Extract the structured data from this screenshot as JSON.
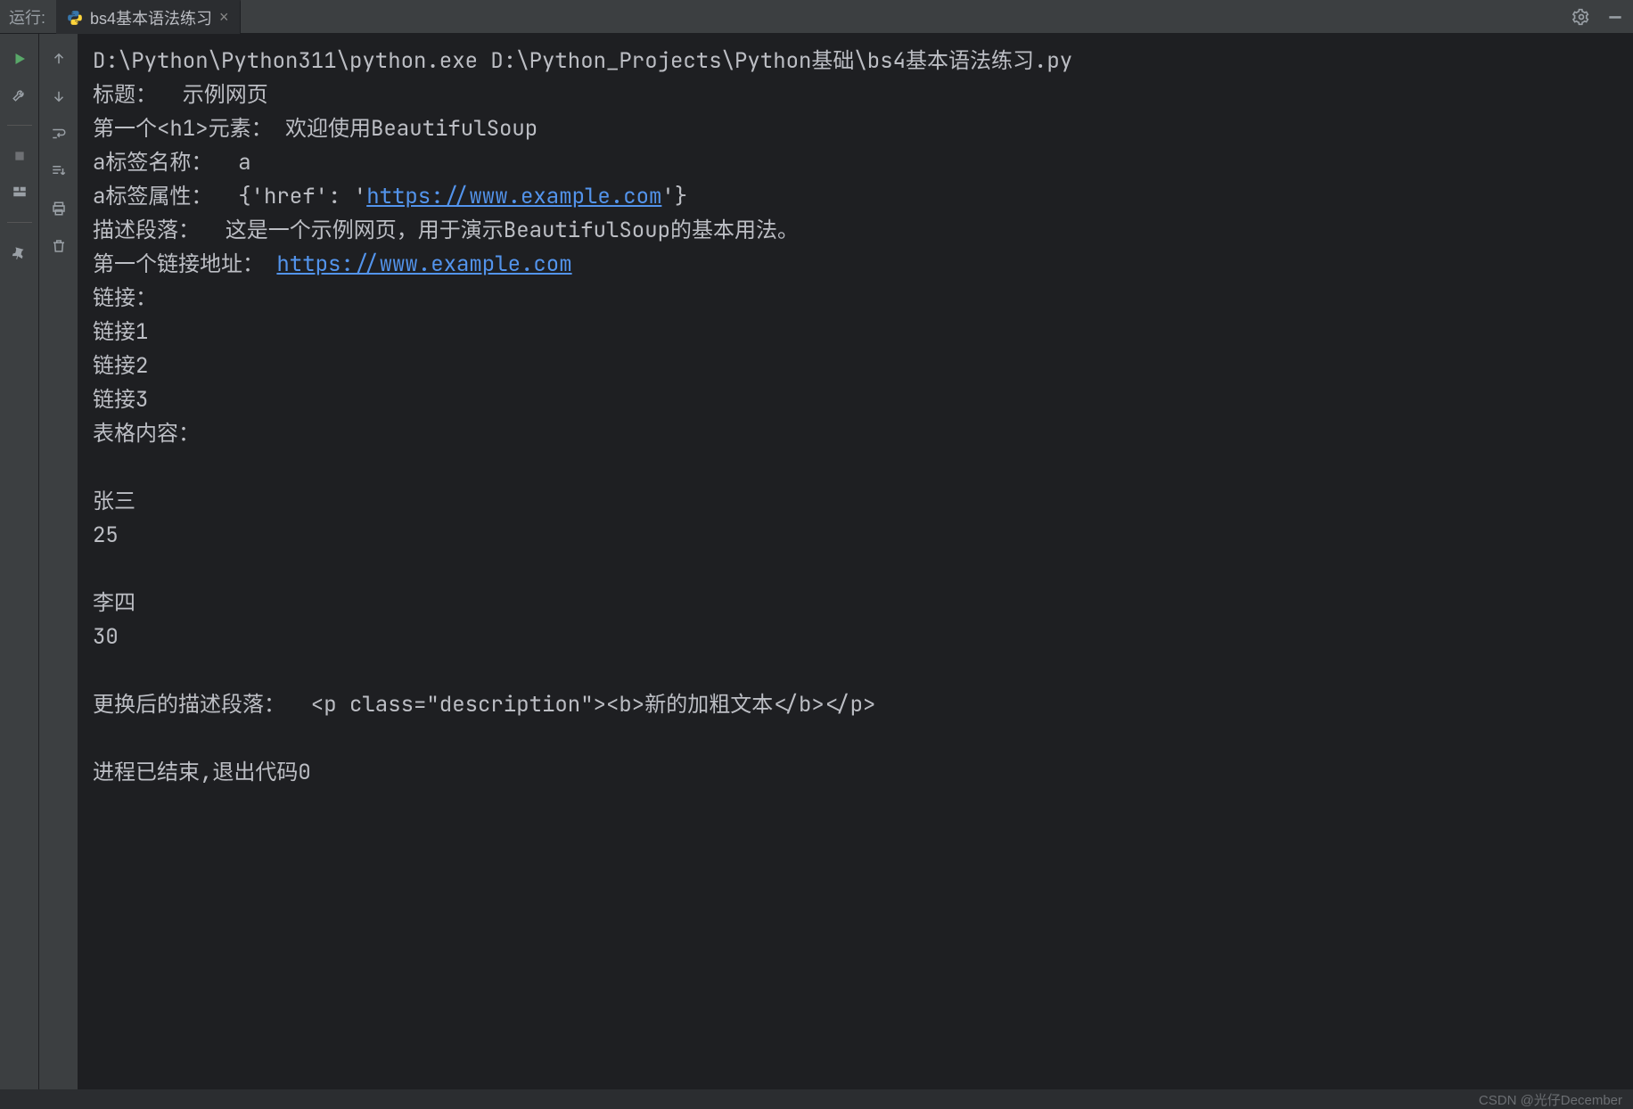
{
  "topbar": {
    "run_label": "运行:",
    "tab_title": "bs4基本语法练习",
    "tab_close": "×"
  },
  "console": {
    "cmd": "D:\\Python\\Python311\\python.exe D:\\Python_Projects\\Python基础\\bs4基本语法练习.py",
    "line_title": "标题：  示例网页",
    "line_h1": "第一个<h1>元素： 欢迎使用BeautifulSoup",
    "line_tagname": "a标签名称：  a",
    "line_attr_before": "a标签属性：  {'href': '",
    "line_attr_url": "https://www.example.com",
    "line_attr_after": "'}",
    "line_desc": "描述段落：  这是一个示例网页，用于演示BeautifulSoup的基本用法。",
    "line_link_before": "第一个链接地址： ",
    "line_link_url": "https://www.example.com",
    "line_links_header": "链接：",
    "line_link1": "链接1",
    "line_link2": "链接2",
    "line_link3": "链接3",
    "line_table": "表格内容：",
    "line_blank1": "",
    "line_zs": "张三",
    "line_25": "25",
    "line_blank2": "",
    "line_ls": "李四",
    "line_30": "30",
    "line_blank3": "",
    "line_replaced": "更换后的描述段落：  <p class=\"description\"><b>新的加粗文本</b></p>",
    "line_blank4": "",
    "line_exit": "进程已结束,退出代码0"
  },
  "footer": {
    "watermark": "CSDN @光仔December"
  }
}
